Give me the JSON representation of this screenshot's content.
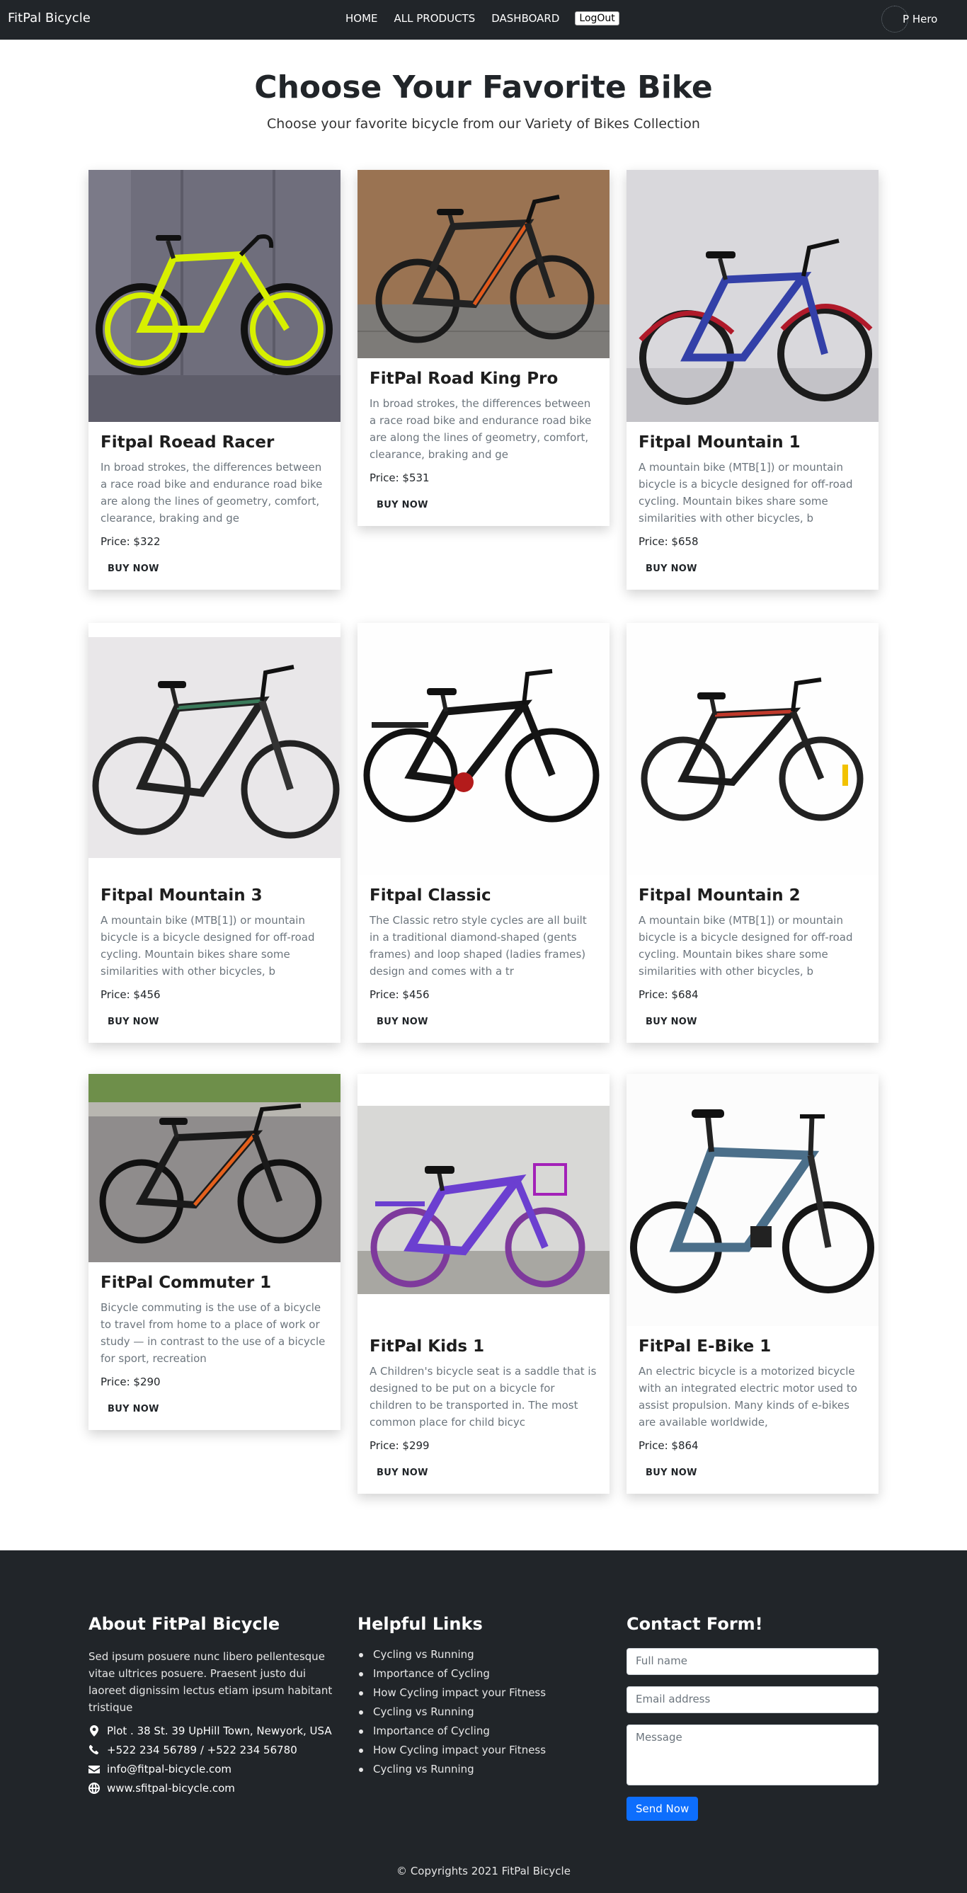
{
  "nav": {
    "brand": "FitPal Bicycle",
    "links": [
      "HOME",
      "ALL PRODUCTS",
      "DASHBOARD"
    ],
    "logout": "LogOut",
    "user_name": "P Hero"
  },
  "hero": {
    "title": "Choose Your Favorite Bike",
    "subtitle": "Choose your favorite bicycle from our Variety of Bikes Collection"
  },
  "products": [
    {
      "name": "Fitpal Roead Racer",
      "description": "In broad strokes, the differences between a race road bike and endurance road bike are along the lines of geometry, comfort, clearance, braking and ge",
      "price": "Price: $322",
      "button": "BUY NOW",
      "image": "yellow-road-bike"
    },
    {
      "name": "FitPal Road King Pro",
      "description": "In broad strokes, the differences between a race road bike and endurance road bike are along the lines of geometry, comfort, clearance, braking and ge",
      "price": "Price: $531",
      "button": "BUY NOW",
      "image": "black-orange-mountain-bike"
    },
    {
      "name": "Fitpal Mountain 1",
      "description": "A mountain bike (MTB[1]) or mountain bicycle is a bicycle designed for off-road cycling. Mountain bikes share some similarities with other bicycles, b",
      "price": "Price: $658",
      "button": "BUY NOW",
      "image": "blue-red-mountain-bike"
    },
    {
      "name": "Fitpal Mountain 3",
      "description": "A mountain bike (MTB[1]) or mountain bicycle is a bicycle designed for off-road cycling. Mountain bikes share some similarities with other bicycles, b",
      "price": "Price: $456",
      "button": "BUY NOW",
      "image": "black-green-mountain-bike"
    },
    {
      "name": "Fitpal Classic",
      "description": "The Classic retro style cycles are all built in a traditional diamond-shaped (gents frames) and loop shaped (ladies frames) design and comes with a tr",
      "price": "Price: $456",
      "button": "BUY NOW",
      "image": "classic-black-bike"
    },
    {
      "name": "Fitpal Mountain 2",
      "description": "A mountain bike (MTB[1]) or mountain bicycle is a bicycle designed for off-road cycling. Mountain bikes share some similarities with other bicycles, b",
      "price": "Price: $684",
      "button": "BUY NOW",
      "image": "black-red-mountain-bike"
    },
    {
      "name": "FitPal Commuter 1",
      "description": "Bicycle commuting is the use of a bicycle to travel from home to a place of work or study — in contrast to the use of a bicycle for sport, recreation",
      "price": "Price: $290",
      "button": "BUY NOW",
      "image": "commuter-bike"
    },
    {
      "name": "FitPal Kids 1",
      "description": "A Children's bicycle seat is a saddle that is designed to be put on a bicycle for children to be transported in. The most common place for child bicyc",
      "price": "Price: $299",
      "button": "BUY NOW",
      "image": "purple-kids-bike"
    },
    {
      "name": "FitPal E-Bike 1",
      "description": "An electric bicycle is a motorized bicycle with an integrated electric motor used to assist propulsion. Many kinds of e-bikes are available worldwide,",
      "price": "Price: $864",
      "button": "BUY NOW",
      "image": "blue-e-bike"
    }
  ],
  "footer": {
    "about_title": "About FitPal Bicycle",
    "about_text": "Sed ipsum posuere nunc libero pellentesque vitae ultrices posuere. Praesent justo dui laoreet dignissim lectus etiam ipsum habitant tristique",
    "address": "Plot . 38 St. 39 UpHill Town, Newyork, USA",
    "phone": "+522 234 56789 / +522 234 56780",
    "email": "info@fitpal-bicycle.com",
    "website": "www.sfitpal-bicycle.com",
    "links_title": "Helpful Links",
    "links": [
      "Cycling vs Running",
      "Importance of Cycling",
      "How Cycling impact your Fitness",
      "Cycling vs Running",
      "Importance of Cycling",
      "How Cycling impact your Fitness",
      "Cycling vs Running"
    ],
    "form_title": "Contact Form!",
    "form_name_placeholder": "Full name",
    "form_email_placeholder": "Email address",
    "form_message_placeholder": "Message",
    "send_label": "Send Now",
    "copyright": "© Copyrights 2021 FitPal Bicycle"
  },
  "colors": {
    "navbar_bg": "#212529",
    "footer_bg": "#212529",
    "send_button": "#0d6efd"
  }
}
